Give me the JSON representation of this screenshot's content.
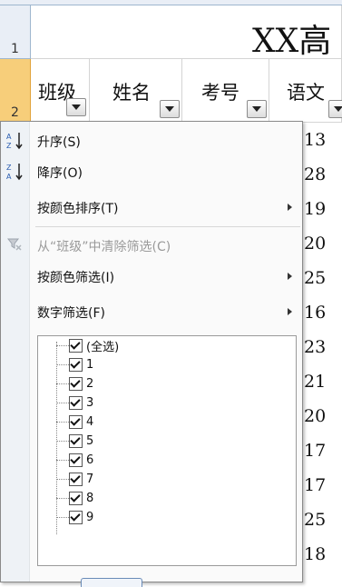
{
  "sheet": {
    "title": "XX高",
    "row_numbers": [
      "1",
      "2"
    ],
    "headers": [
      {
        "label": "班级"
      },
      {
        "label": "姓名"
      },
      {
        "label": "考号"
      },
      {
        "label": "语文"
      }
    ],
    "chinese_values": [
      "13",
      "28",
      "19",
      "20",
      "25",
      "16",
      "23",
      "21",
      "20",
      "17",
      "17",
      "25",
      "18"
    ]
  },
  "menu": {
    "items": [
      {
        "label": "升序(S)",
        "icon": "sort-asc-icon",
        "disabled": false,
        "submenu": false
      },
      {
        "label": "降序(O)",
        "icon": "sort-desc-icon",
        "disabled": false,
        "submenu": false
      },
      {
        "label": "按颜色排序(T)",
        "icon": "",
        "disabled": false,
        "submenu": true
      },
      {
        "label": "从“班级”中清除筛选(C)",
        "icon": "clear-filter-icon",
        "disabled": true,
        "submenu": false
      },
      {
        "label": "按颜色筛选(I)",
        "icon": "",
        "disabled": false,
        "submenu": true
      },
      {
        "label": "数字筛选(F)",
        "icon": "",
        "disabled": false,
        "submenu": true
      }
    ],
    "filter_values": [
      {
        "label": "(全选)",
        "checked": true
      },
      {
        "label": "1",
        "checked": true
      },
      {
        "label": "2",
        "checked": true
      },
      {
        "label": "3",
        "checked": true
      },
      {
        "label": "4",
        "checked": true
      },
      {
        "label": "5",
        "checked": true
      },
      {
        "label": "6",
        "checked": true
      },
      {
        "label": "7",
        "checked": true
      },
      {
        "label": "8",
        "checked": true
      },
      {
        "label": "9",
        "checked": true
      }
    ]
  },
  "colors": {
    "selected_row_header": "#f7ce7a",
    "header_bg": "#e9eef6",
    "menu_gutter": "#eef2f6"
  }
}
